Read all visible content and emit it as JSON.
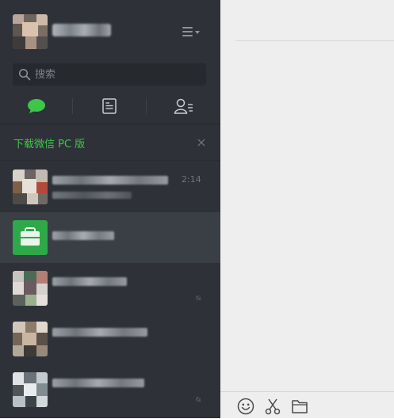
{
  "search": {
    "placeholder": "搜索"
  },
  "tabs": [
    {
      "name": "chat",
      "icon": "chat-bubble-icon",
      "active": true
    },
    {
      "name": "public",
      "icon": "article-icon",
      "active": false
    },
    {
      "name": "contacts",
      "icon": "contacts-icon",
      "active": false
    }
  ],
  "download_banner": {
    "label": "下载微信 PC 版",
    "close_icon": "close-icon"
  },
  "chats": [
    {
      "time": "2:14",
      "muted": false,
      "active": false
    },
    {
      "time": "",
      "muted": false,
      "active": true
    },
    {
      "time": "",
      "muted": true,
      "active": false
    },
    {
      "time": "",
      "muted": false,
      "active": false
    },
    {
      "time": "",
      "muted": true,
      "active": false
    }
  ],
  "toolbar": {
    "emoji_icon": "emoji-icon",
    "screenshot_icon": "scissors-icon",
    "file_icon": "folder-icon"
  },
  "colors": {
    "sidebar": "#2e3238",
    "active_chat": "#3a3f45",
    "accent_green": "#3ec64a",
    "main_bg": "#eeeeee"
  }
}
